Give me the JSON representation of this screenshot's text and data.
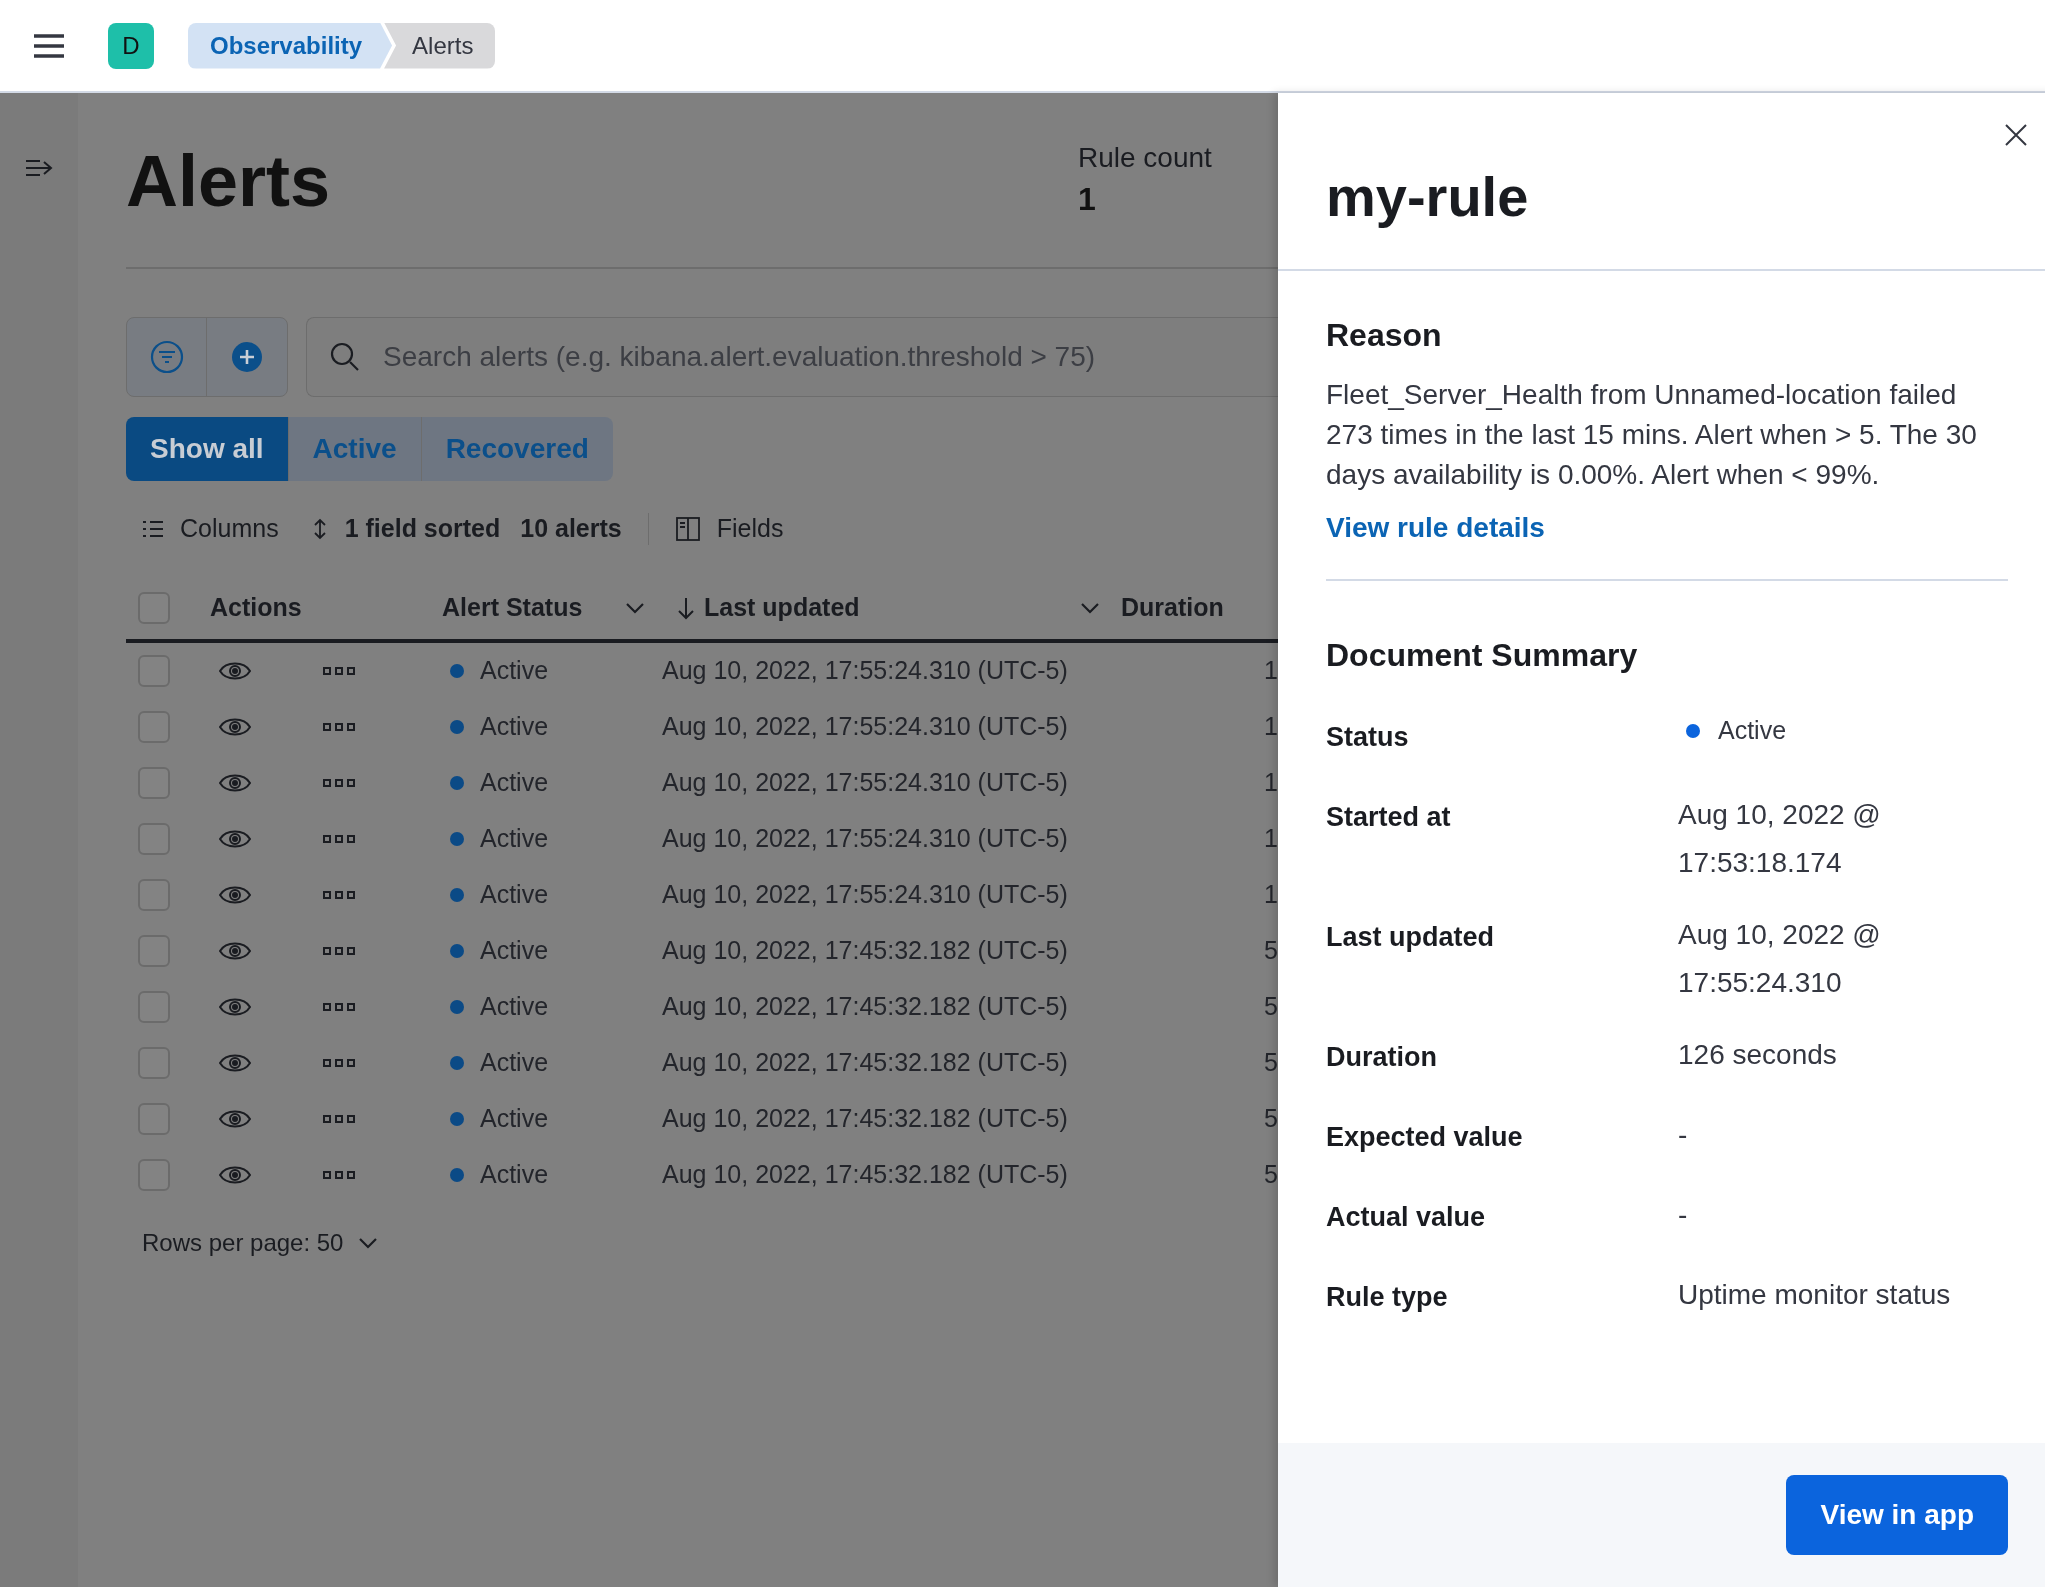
{
  "header": {
    "avatar": "D",
    "breadcrumbs": [
      {
        "label": "Observability",
        "selected": false
      },
      {
        "label": "Alerts",
        "selected": true
      }
    ]
  },
  "page": {
    "title": "Alerts",
    "stats": [
      {
        "label": "Rule count",
        "value": "1"
      }
    ]
  },
  "search": {
    "placeholder": "Search alerts (e.g. kibana.alert.evaluation.threshold > 75)"
  },
  "filter_tabs": [
    {
      "label": "Show all",
      "selected": true
    },
    {
      "label": "Active",
      "selected": false
    },
    {
      "label": "Recovered",
      "selected": false
    }
  ],
  "toolbar": {
    "columns": "Columns",
    "sorted": "1 field sorted",
    "count": "10 alerts",
    "fields": "Fields"
  },
  "table": {
    "select_all_checked": false,
    "columns": [
      "Actions",
      "Alert Status",
      "Last updated",
      "Duration"
    ],
    "rows": [
      {
        "checked": false,
        "status": "Active",
        "last_updated": "Aug 10, 2022, 17:55:24.310 (UTC-5)",
        "duration": "1"
      },
      {
        "checked": false,
        "status": "Active",
        "last_updated": "Aug 10, 2022, 17:55:24.310 (UTC-5)",
        "duration": "1"
      },
      {
        "checked": false,
        "status": "Active",
        "last_updated": "Aug 10, 2022, 17:55:24.310 (UTC-5)",
        "duration": "1"
      },
      {
        "checked": false,
        "status": "Active",
        "last_updated": "Aug 10, 2022, 17:55:24.310 (UTC-5)",
        "duration": "1"
      },
      {
        "checked": false,
        "status": "Active",
        "last_updated": "Aug 10, 2022, 17:55:24.310 (UTC-5)",
        "duration": "1"
      },
      {
        "checked": false,
        "status": "Active",
        "last_updated": "Aug 10, 2022, 17:45:32.182 (UTC-5)",
        "duration": "5"
      },
      {
        "checked": false,
        "status": "Active",
        "last_updated": "Aug 10, 2022, 17:45:32.182 (UTC-5)",
        "duration": "5"
      },
      {
        "checked": false,
        "status": "Active",
        "last_updated": "Aug 10, 2022, 17:45:32.182 (UTC-5)",
        "duration": "5"
      },
      {
        "checked": false,
        "status": "Active",
        "last_updated": "Aug 10, 2022, 17:45:32.182 (UTC-5)",
        "duration": "5"
      },
      {
        "checked": false,
        "status": "Active",
        "last_updated": "Aug 10, 2022, 17:45:32.182 (UTC-5)",
        "duration": "5"
      }
    ],
    "rows_per_page": "Rows per page: 50"
  },
  "flyout": {
    "title": "my-rule",
    "reason_heading": "Reason",
    "reason": "Fleet_Server_Health from Unnamed-location failed 273 times in the last 15 mins. Alert when > 5. The 30 days availability is 0.00%. Alert when < 99%.",
    "link": "View rule details",
    "summary_heading": "Document Summary",
    "fields": [
      {
        "kind": "status",
        "label": "Status",
        "value": "Active"
      },
      {
        "kind": "text",
        "label": "Started at",
        "value": "Aug 10, 2022 @ 17:53:18.174"
      },
      {
        "kind": "text",
        "label": "Last updated",
        "value": "Aug 10, 2022 @ 17:55:24.310"
      },
      {
        "kind": "text",
        "label": "Duration",
        "value": "126 seconds"
      },
      {
        "kind": "text",
        "label": "Expected value",
        "value": "-"
      },
      {
        "kind": "text",
        "label": "Actual value",
        "value": "-"
      },
      {
        "kind": "text",
        "label": "Rule type",
        "value": "Uptime monitor status"
      }
    ],
    "button": "View in app"
  }
}
